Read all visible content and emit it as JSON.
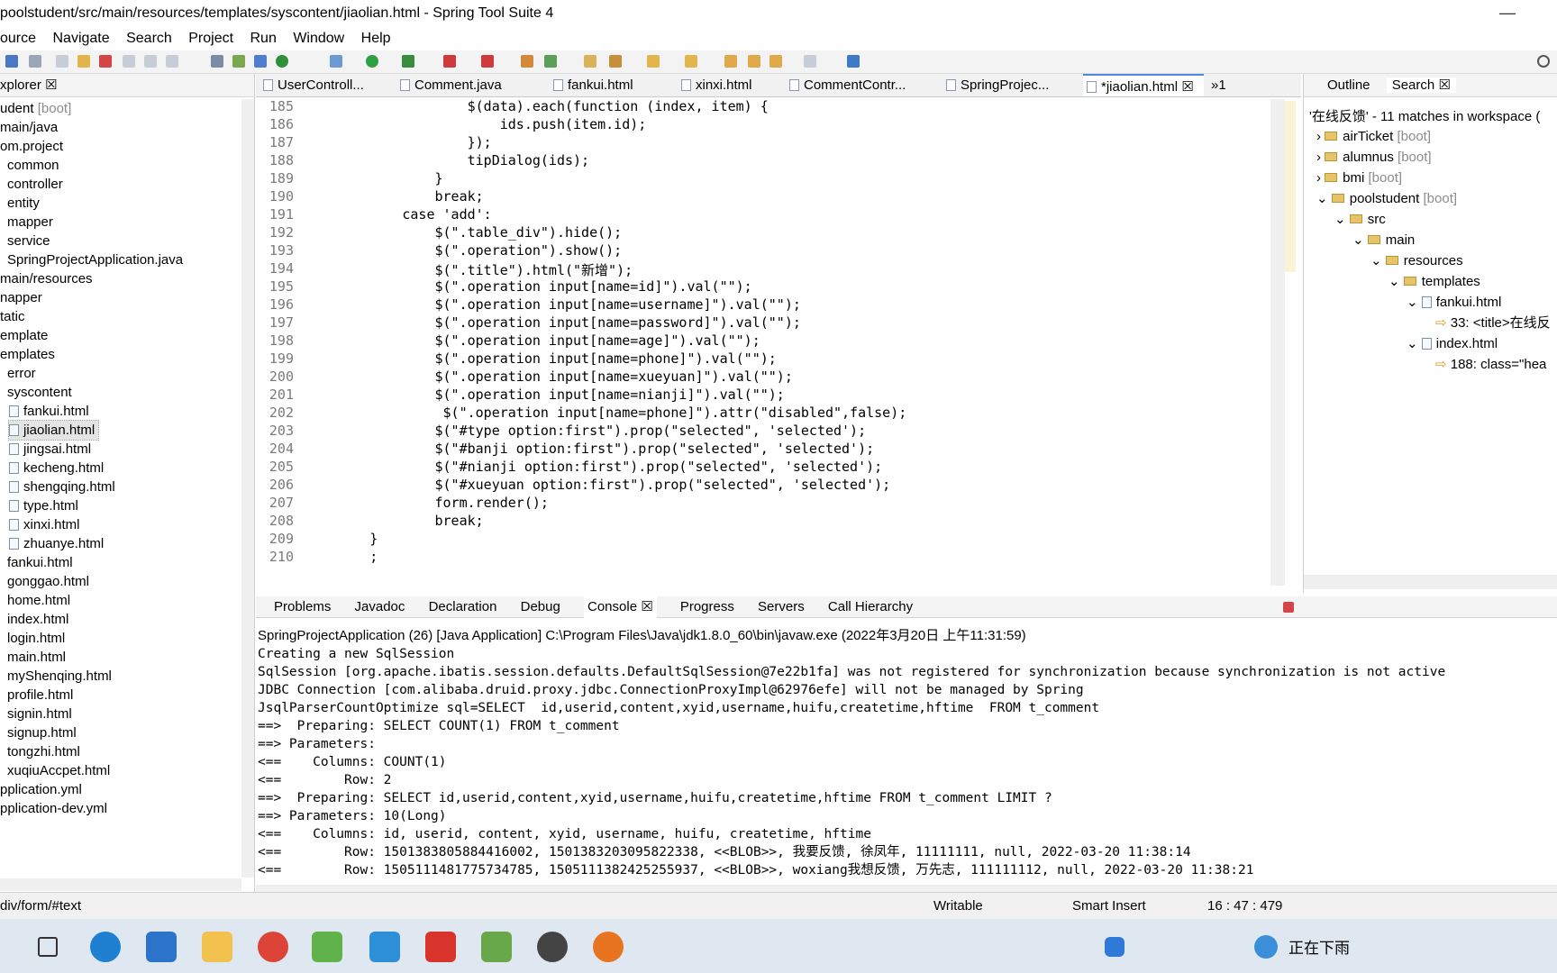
{
  "window": {
    "title": "poolstudent/src/main/resources/templates/syscontent/jiaolian.html - Spring Tool Suite 4",
    "minimize": "—"
  },
  "menu": [
    "ource",
    "Navigate",
    "Search",
    "Project",
    "Run",
    "Window",
    "Help"
  ],
  "explorer": {
    "title": "xplorer ☒",
    "items": [
      {
        "label": "udent",
        "suffix": "[boot]"
      },
      {
        "label": "main/java"
      },
      {
        "label": "om.project"
      },
      {
        "label": "common"
      },
      {
        "label": "controller"
      },
      {
        "label": "entity"
      },
      {
        "label": "mapper"
      },
      {
        "label": "service"
      },
      {
        "label": "SpringProjectApplication.java"
      },
      {
        "label": "main/resources"
      },
      {
        "label": "napper"
      },
      {
        "label": "tatic"
      },
      {
        "label": "emplate"
      },
      {
        "label": "emplates"
      },
      {
        "label": "error"
      },
      {
        "label": "syscontent"
      },
      {
        "label": "fankui.html"
      },
      {
        "label": "jiaolian.html"
      },
      {
        "label": "jingsai.html"
      },
      {
        "label": "kecheng.html"
      },
      {
        "label": "shengqing.html"
      },
      {
        "label": "type.html"
      },
      {
        "label": "xinxi.html"
      },
      {
        "label": "zhuanye.html"
      },
      {
        "label": "fankui.html"
      },
      {
        "label": "gonggao.html"
      },
      {
        "label": "home.html"
      },
      {
        "label": "index.html"
      },
      {
        "label": "login.html"
      },
      {
        "label": "main.html"
      },
      {
        "label": "myShenqing.html"
      },
      {
        "label": "profile.html"
      },
      {
        "label": "signin.html"
      },
      {
        "label": "signup.html"
      },
      {
        "label": "tongzhi.html"
      },
      {
        "label": "xuqiuAccpet.html"
      },
      {
        "label": "pplication.yml"
      },
      {
        "label": "pplication-dev.yml"
      }
    ]
  },
  "editor": {
    "tabs": [
      "UserControll...",
      "Comment.java",
      "fankui.html",
      "xinxi.html",
      "CommentContr...",
      "SpringProjec...",
      "*jiaolian.html ☒",
      "»1"
    ],
    "lines": [
      {
        "n": "185",
        "t": "                    $(data).each(function (index, item) {"
      },
      {
        "n": "186",
        "t": "                        ids.push(item.id);"
      },
      {
        "n": "187",
        "t": "                    });"
      },
      {
        "n": "188",
        "t": "                    tipDialog(ids);"
      },
      {
        "n": "189",
        "t": "                }"
      },
      {
        "n": "190",
        "t": "                break;"
      },
      {
        "n": "191",
        "t": "            case 'add':"
      },
      {
        "n": "192",
        "t": "                $(\".table_div\").hide();"
      },
      {
        "n": "193",
        "t": "                $(\".operation\").show();"
      },
      {
        "n": "194",
        "t": "                $(\".title\").html(\"新增\");"
      },
      {
        "n": "195",
        "t": "                $(\".operation input[name=id]\").val(\"\");"
      },
      {
        "n": "196",
        "t": "                $(\".operation input[name=username]\").val(\"\");"
      },
      {
        "n": "197",
        "t": "                $(\".operation input[name=password]\").val(\"\");"
      },
      {
        "n": "198",
        "t": "                $(\".operation input[name=age]\").val(\"\");"
      },
      {
        "n": "199",
        "t": "                $(\".operation input[name=phone]\").val(\"\");"
      },
      {
        "n": "200",
        "t": "                $(\".operation input[name=xueyuan]\").val(\"\");"
      },
      {
        "n": "201",
        "t": "                $(\".operation input[name=nianji]\").val(\"\");"
      },
      {
        "n": "202",
        "t": "                 $(\".operation input[name=phone]\").attr(\"disabled\",false);"
      },
      {
        "n": "203",
        "t": "                $(\"#type option:first\").prop(\"selected\", 'selected');"
      },
      {
        "n": "204",
        "t": "                $(\"#banji option:first\").prop(\"selected\", 'selected');"
      },
      {
        "n": "205",
        "t": "                $(\"#nianji option:first\").prop(\"selected\", 'selected');"
      },
      {
        "n": "206",
        "t": "                $(\"#xueyuan option:first\").prop(\"selected\", 'selected');"
      },
      {
        "n": "207",
        "t": "                form.render();"
      },
      {
        "n": "208",
        "t": "                break;"
      },
      {
        "n": "209",
        "t": "        }"
      },
      {
        "n": "210",
        "t": "        ;"
      }
    ]
  },
  "outline": {
    "tab1": "Outline",
    "tab2": "Search ☒",
    "summary": "'在线反馈' - 11 matches in workspace (",
    "items": [
      {
        "label": "airTicket",
        "suffix": "[boot]"
      },
      {
        "label": "alumnus",
        "suffix": "[boot]"
      },
      {
        "label": "bmi",
        "suffix": "[boot]"
      },
      {
        "label": "poolstudent",
        "suffix": "[boot]"
      },
      {
        "label": "src"
      },
      {
        "label": "main"
      },
      {
        "label": "resources"
      },
      {
        "label": "templates"
      },
      {
        "label": "fankui.html"
      },
      {
        "label": "33: <title>在线反"
      },
      {
        "label": "index.html"
      },
      {
        "label": "188: class=\"hea"
      }
    ]
  },
  "console": {
    "tabs": [
      "Problems",
      "Javadoc",
      "Declaration",
      "Debug",
      "Console ☒",
      "Progress",
      "Servers",
      "Call Hierarchy"
    ],
    "header": "SpringProjectApplication (26) [Java Application] C:\\Program Files\\Java\\jdk1.8.0_60\\bin\\javaw.exe  (2022年3月20日 上午11:31:59)",
    "lines": [
      "Creating a new SqlSession",
      "SqlSession [org.apache.ibatis.session.defaults.DefaultSqlSession@7e22b1fa] was not registered for synchronization because synchronization is not active",
      "JDBC Connection [com.alibaba.druid.proxy.jdbc.ConnectionProxyImpl@62976efe] will not be managed by Spring",
      "JsqlParserCountOptimize sql=SELECT  id,userid,content,xyid,username,huifu,createtime,hftime  FROM t_comment",
      "==>  Preparing: SELECT COUNT(1) FROM t_comment",
      "==> Parameters: ",
      "<==    Columns: COUNT(1)",
      "<==        Row: 2",
      "==>  Preparing: SELECT id,userid,content,xyid,username,huifu,createtime,hftime FROM t_comment LIMIT ?",
      "==> Parameters: 10(Long)",
      "<==    Columns: id, userid, content, xyid, username, huifu, createtime, hftime",
      "<==        Row: 1501383805884416002, 1501383203095822338, <<BLOB>>, 我要反馈, 徐凤年, 11111111, null, 2022-03-20 11:38:14",
      "<==        Row: 1505111481775734785, 1505111382425255937, <<BLOB>>, woxiang我想反馈, 万先志, 111111112, null, 2022-03-20 11:38:21"
    ]
  },
  "status": {
    "path": "div/form/#text",
    "writable": "Writable",
    "insert": "Smart Insert",
    "position": "16 : 47 : 479"
  },
  "taskbar": {
    "weather": "正在下雨"
  }
}
